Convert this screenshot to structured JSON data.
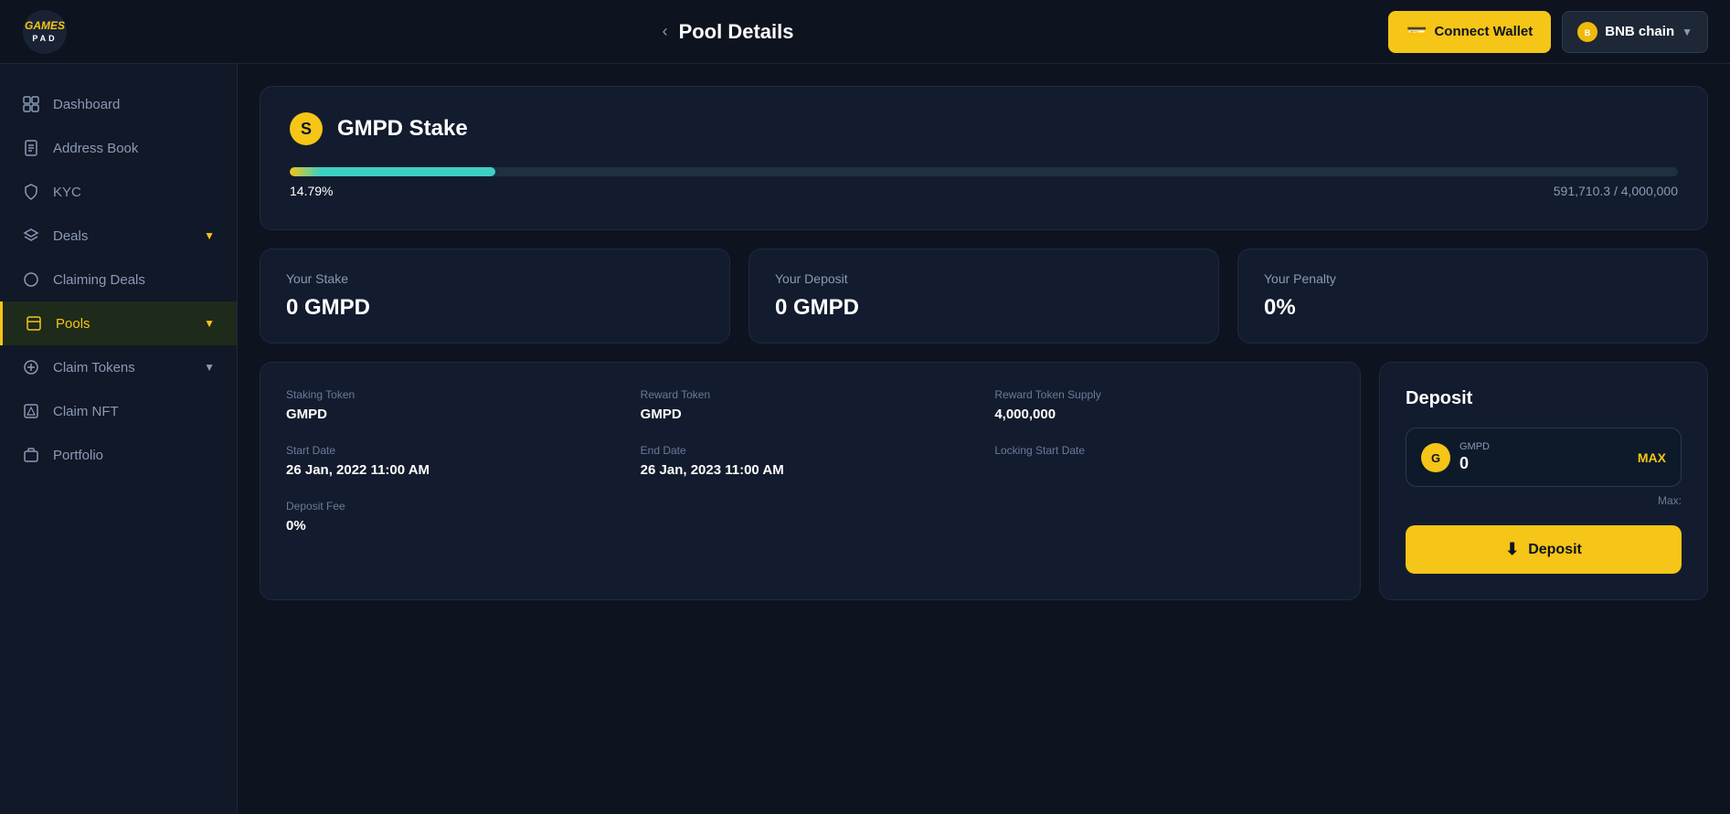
{
  "header": {
    "title": "Pool Details",
    "back_label": "‹",
    "connect_wallet_label": "Connect Wallet",
    "chain_label": "BNB chain",
    "chain_icon": "B"
  },
  "logo": {
    "line1": "GAMES",
    "line2": "PAD"
  },
  "sidebar": {
    "items": [
      {
        "id": "dashboard",
        "label": "Dashboard",
        "icon": "grid",
        "active": false
      },
      {
        "id": "address-book",
        "label": "Address Book",
        "icon": "book",
        "active": false
      },
      {
        "id": "kyc",
        "label": "KYC",
        "icon": "shield",
        "active": false
      },
      {
        "id": "deals",
        "label": "Deals",
        "icon": "layers",
        "active": false,
        "has_chevron": true
      },
      {
        "id": "claiming-deals",
        "label": "Claiming Deals",
        "icon": "circle",
        "active": false
      },
      {
        "id": "pools",
        "label": "Pools",
        "icon": "box",
        "active": true,
        "has_chevron": true
      },
      {
        "id": "claim-tokens",
        "label": "Claim Tokens",
        "icon": "circle",
        "active": false,
        "has_chevron": true
      },
      {
        "id": "claim-nft",
        "label": "Claim NFT",
        "icon": "layers2",
        "active": false
      },
      {
        "id": "portfolio",
        "label": "Portfolio",
        "icon": "briefcase",
        "active": false
      }
    ]
  },
  "pool": {
    "icon_label": "S",
    "name": "GMPD Stake",
    "progress_percent": 14.79,
    "progress_label": "14.79%",
    "progress_amount": "591,710.3 / 4,000,000",
    "your_stake_label": "Your Stake",
    "your_stake_value": "0 GMPD",
    "your_deposit_label": "Your Deposit",
    "your_deposit_value": "0 GMPD",
    "your_penalty_label": "Your Penalty",
    "your_penalty_value": "0%",
    "staking_token_label": "Staking Token",
    "staking_token_value": "GMPD",
    "reward_token_label": "Reward Token",
    "reward_token_value": "GMPD",
    "reward_token_supply_label": "Reward Token Supply",
    "reward_token_supply_value": "4,000,000",
    "start_date_label": "Start Date",
    "start_date_value": "26 Jan, 2022 11:00 AM",
    "end_date_label": "End Date",
    "end_date_value": "26 Jan, 2023 11:00 AM",
    "locking_start_date_label": "Locking Start Date",
    "locking_start_date_value": "",
    "deposit_fee_label": "Deposit Fee",
    "deposit_fee_value": "0%"
  },
  "deposit": {
    "title": "Deposit",
    "token_label": "GMPD",
    "token_icon": "G",
    "amount_value": "0",
    "max_btn_label": "MAX",
    "max_balance_label": "Max:",
    "max_balance_value": "",
    "deposit_btn_label": "Deposit"
  }
}
